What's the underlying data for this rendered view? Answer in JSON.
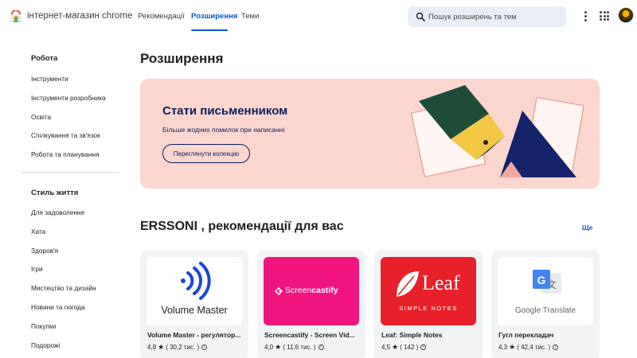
{
  "header": {
    "brand": "інтернет-магазин chrome",
    "tabs": [
      "Рекомендації",
      "Розширення",
      "Теми"
    ],
    "active_tab": "Розширення",
    "search_placeholder": "Пошук розширень та тем"
  },
  "sidebar": {
    "section1": {
      "title": "Робота",
      "items": [
        "Інструменти",
        "Інструменти розробника",
        "Освіта",
        "Спілкування та зв'язок",
        "Робота та планування"
      ]
    },
    "section2": {
      "title": "Стиль життя",
      "items": [
        "Для задоволення",
        "Хата",
        "Здоров'я",
        "Ігри",
        "Мистецтво та дизайн",
        "Новини та погода",
        "Покупки",
        "Подорожі"
      ]
    }
  },
  "main": {
    "title": "Розширення",
    "banner": {
      "title": "Стати письменником",
      "subtitle": "Більше жодних помилок при написанні",
      "button": "Переглянути колекцію"
    },
    "recommend_title": "ERSSONI , рекомендації для вас",
    "more": "Ще",
    "cards": [
      {
        "name": "Volume Master - регулятор...",
        "rating": "4,8",
        "count": "( 30,2 тис. )",
        "image_text": "Volume Master",
        "bg": "#ffffff"
      },
      {
        "name": "Screencastify - Screen Vid...",
        "rating": "4,0",
        "count": "( 11,6 тис. )",
        "image_text_a": "Screen",
        "image_text_b": "castify",
        "bg": "#f0157e"
      },
      {
        "name": "Leaf: Simple Notes",
        "rating": "4,5",
        "count": "( 142 )",
        "image_text_a": "Leaf",
        "image_text_b": "SIMPLE NOTES",
        "bg": "#e8202a"
      },
      {
        "name": "Гугл перекладач",
        "rating": "4,3",
        "count": "( 42,4 тис. )",
        "image_text": "Google Translate",
        "bg": "#ffffff"
      }
    ]
  },
  "colors": {
    "accent": "#0b57d0",
    "banner_bg": "#fdd6cf",
    "banner_text": "#0b1d5b"
  }
}
